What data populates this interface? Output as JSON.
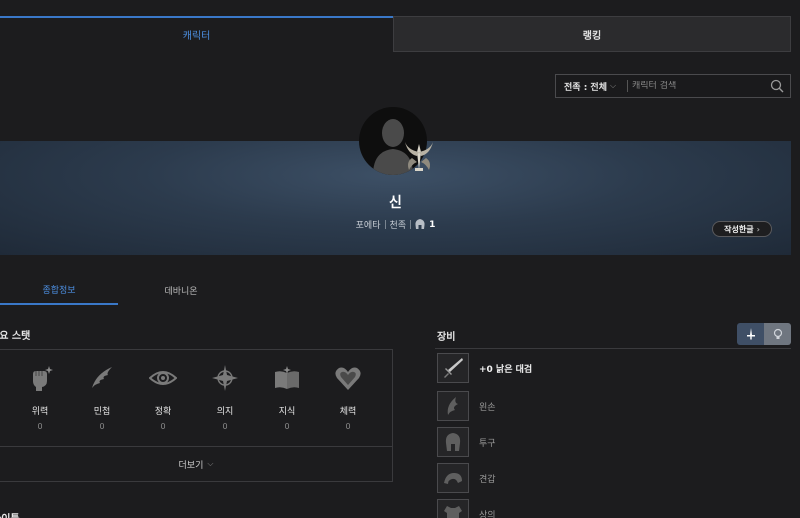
{
  "tabs": {
    "character": "캐릭터",
    "ranking": "랭킹"
  },
  "search": {
    "race_label": "전족 : 전체",
    "placeholder": "캐릭터 검색"
  },
  "profile": {
    "name": "신",
    "class": "포에타",
    "race": "천족",
    "level": "1",
    "guild_button": "작성한글"
  },
  "sub_tabs": {
    "overview": "종합정보",
    "daevanion": "데바니온"
  },
  "stats": {
    "title": "주요 스탯",
    "items": [
      {
        "name": "위력",
        "value": "0",
        "icon": "fist-icon"
      },
      {
        "name": "민첩",
        "value": "0",
        "icon": "wing-icon"
      },
      {
        "name": "정확",
        "value": "0",
        "icon": "eye-icon"
      },
      {
        "name": "의지",
        "value": "0",
        "icon": "burst-icon"
      },
      {
        "name": "지식",
        "value": "0",
        "icon": "book-icon"
      },
      {
        "name": "체력",
        "value": "0",
        "icon": "heart-icon"
      }
    ],
    "more": "더보기"
  },
  "equipment": {
    "title": "장비",
    "items": [
      {
        "label": "+0 낡은 대검",
        "icon": "greatsword-icon",
        "equipped": true
      },
      {
        "label": "왼손",
        "icon": "offhand-icon",
        "equipped": false
      },
      {
        "label": "투구",
        "icon": "helmet-icon",
        "equipped": false
      },
      {
        "label": "견갑",
        "icon": "shoulder-icon",
        "equipped": false
      },
      {
        "label": "상의",
        "icon": "chest-icon",
        "equipped": false
      }
    ]
  },
  "bottom": {
    "title": "타이틀"
  },
  "colors": {
    "accent": "#3a78c8",
    "background": "#1c1c1e",
    "banner": "#2c3b4d"
  }
}
